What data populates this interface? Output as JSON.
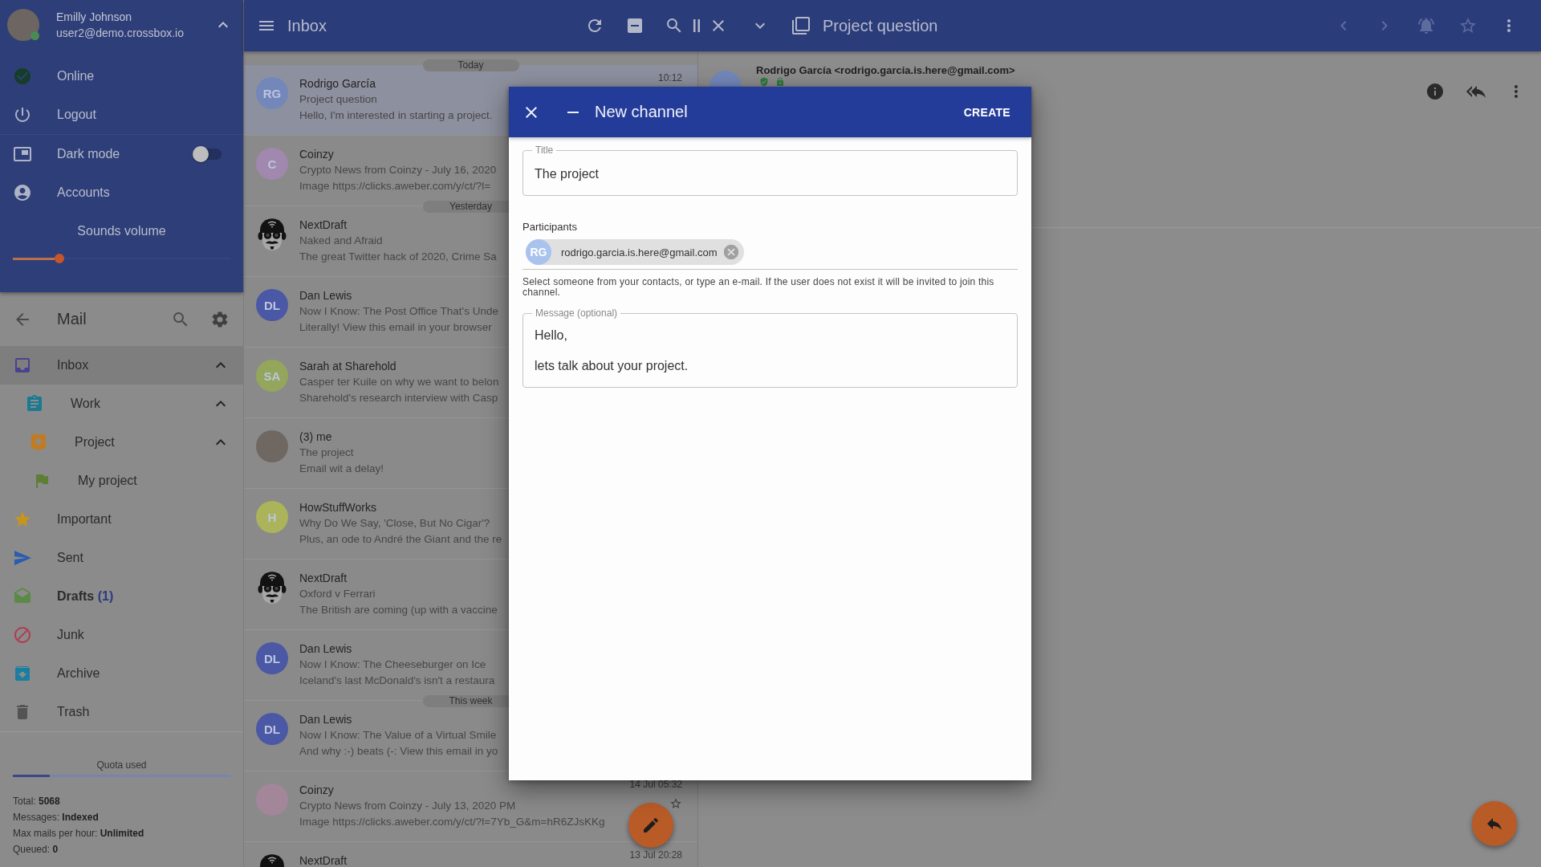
{
  "account_panel": {
    "user": {
      "name": "Emilly Johnson",
      "email": "user2@demo.crossbox.io",
      "online": true
    },
    "expanded": true,
    "items": [
      {
        "kind": "status",
        "label": "Online"
      },
      {
        "kind": "logout",
        "label": "Logout"
      },
      {
        "kind": "dark_mode",
        "label": "Dark mode",
        "on": false
      },
      {
        "kind": "accounts",
        "label": "Accounts"
      }
    ],
    "volume": {
      "label": "Sounds volume",
      "level": 0.2
    }
  },
  "mail_nav": {
    "title": "Mail",
    "folders": [
      {
        "kind": "inbox",
        "label": "Inbox",
        "selected": true,
        "expanded": true,
        "children": [
          {
            "kind": "work",
            "label": "Work",
            "selected": false,
            "expanded": true,
            "children": [
              {
                "kind": "project",
                "label": "Project",
                "selected": false,
                "expanded": true,
                "children": [
                  {
                    "kind": "flag",
                    "label": "My project",
                    "selected": false
                  }
                ]
              }
            ]
          }
        ]
      },
      {
        "kind": "important",
        "label": "Important",
        "selected": false
      },
      {
        "kind": "sent",
        "label": "Sent",
        "selected": false
      },
      {
        "kind": "drafts",
        "label": "Drafts",
        "count": "(1)",
        "selected": false
      },
      {
        "kind": "junk",
        "label": "Junk",
        "selected": false
      },
      {
        "kind": "archive",
        "label": "Archive",
        "selected": false
      },
      {
        "kind": "trash",
        "label": "Trash",
        "selected": false
      }
    ],
    "quota": {
      "label": "Quota used",
      "level": 0.17
    },
    "stats": [
      "Total: **5068**",
      "Messages: **Indexed**",
      "Max mails per hour: **Unlimited**",
      "Queued: **0**"
    ]
  },
  "toolbar": {
    "folder_title": "Inbox",
    "message_title": "Project question"
  },
  "messages": [
    {
      "kind": "date",
      "label": "Today"
    },
    {
      "kind": "message",
      "sender": "Rodrigo García",
      "subject": "Project question",
      "preview": "Hello, I'm interested in starting a project.",
      "time": "10:12",
      "selected": true,
      "avatar": {
        "kind": "initials",
        "initials": "RG",
        "color": "#7387bb"
      }
    },
    {
      "kind": "message",
      "sender": "Coinzy",
      "subject": "Crypto News from Coinzy - July 16, 2020",
      "preview": "Image https://clicks.aweber.com/y/ct/?l=",
      "selected": false,
      "avatar": {
        "kind": "initials",
        "initials": "C",
        "color": "#a088ae"
      }
    },
    {
      "kind": "date",
      "label": "Yesterday"
    },
    {
      "kind": "message",
      "sender": "NextDraft",
      "subject": "Naked and Afraid",
      "preview": "The great Twitter hack of 2020, Crime Sa",
      "selected": false,
      "avatar": {
        "kind": "cartoon"
      }
    },
    {
      "kind": "message",
      "sender": "Dan Lewis",
      "subject": "Now I Know: The Post Office That's Unde",
      "preview": "Literally! View this email in your browser",
      "selected": false,
      "avatar": {
        "kind": "initials",
        "initials": "DL",
        "color": "#4a58a5"
      }
    },
    {
      "kind": "message",
      "sender": "Sarah at Sharehold",
      "subject": "Casper ter Kuile on why we want to belon",
      "preview": "Sharehold's research interview with Casp",
      "selected": false,
      "avatar": {
        "kind": "initials",
        "initials": "SA",
        "color": "#93a65b"
      }
    },
    {
      "kind": "message",
      "sender": "(3) me",
      "subject": "The project",
      "preview": "Email wit a delay!",
      "selected": false,
      "avatar": {
        "kind": "photo"
      }
    },
    {
      "kind": "message",
      "sender": "HowStuffWorks",
      "subject": "Why Do We Say, 'Close, But No Cigar'?",
      "preview": "Plus, an ode to André the Giant and the re",
      "selected": false,
      "avatar": {
        "kind": "initials",
        "initials": "H",
        "color": "#abb45a"
      }
    },
    {
      "kind": "message",
      "sender": "NextDraft",
      "subject": "Oxford v Ferrari",
      "preview": "The British are coming (up with a vaccine",
      "selected": false,
      "avatar": {
        "kind": "cartoon"
      }
    },
    {
      "kind": "message",
      "sender": "Dan Lewis",
      "subject": "Now I Know: The Cheeseburger on Ice",
      "preview": "Iceland's last McDonald's isn't a restaura",
      "selected": false,
      "avatar": {
        "kind": "initials",
        "initials": "DL",
        "color": "#4a58a5"
      }
    },
    {
      "kind": "date",
      "label": "This week"
    },
    {
      "kind": "message",
      "sender": "Dan Lewis",
      "subject": "Now I Know: The Value of a Virtual Smile",
      "preview": "And why :-) beats (-: View this email in yo",
      "selected": false,
      "avatar": {
        "kind": "initials",
        "initials": "DL",
        "color": "#4a58a5"
      }
    },
    {
      "kind": "message",
      "sender": "Coinzy",
      "subject": "Crypto News from Coinzy - July 13, 2020 PM",
      "preview": "Image https://clicks.aweber.com/y/ct/?l=7Yb_G&m=hR6ZJsKKg",
      "time": "14 Jul 05:32",
      "starred": false,
      "selected": false,
      "avatar": {
        "kind": "logo"
      }
    },
    {
      "kind": "message",
      "sender": "NextDraft",
      "time": "13 Jul 20:28",
      "selected": false,
      "avatar": {
        "kind": "cartoon"
      }
    }
  ],
  "reader": {
    "from": "Rodrigo García <rodrigo.garcia.is.here@gmail.com>"
  },
  "dialog": {
    "title": "New channel",
    "action": "CREATE",
    "title_field": {
      "label": "Title",
      "value": "The project"
    },
    "participants": {
      "label": "Participants",
      "chips": [
        {
          "initials": "RG",
          "email": "rodrigo.garcia.is.here@gmail.com"
        }
      ],
      "help": "Select someone from your contacts, or type an e-mail. If the user does not exist it will be invited to join this channel."
    },
    "message_field": {
      "label": "Message (optional)",
      "value": "Hello,\n\nlets talk about your project."
    }
  }
}
